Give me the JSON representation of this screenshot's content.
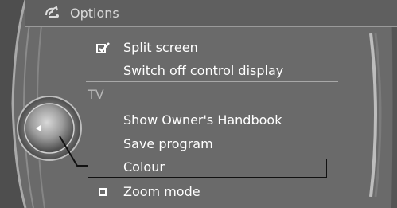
{
  "header": {
    "title": "Options",
    "icon": "options-icon"
  },
  "menu": {
    "items": [
      {
        "label": "Split screen",
        "icon": "checkmark-icon",
        "checked": true
      },
      {
        "label": "Switch off control display"
      },
      {
        "section": "TV"
      },
      {
        "label": "Show Owner's Handbook"
      },
      {
        "label": "Save program"
      },
      {
        "label": "Colour",
        "selected": true
      },
      {
        "label": "Zoom mode",
        "icon": "checkbox-icon",
        "checked": false
      }
    ]
  },
  "controller": {
    "icon": "controller-knob-icon",
    "direction_icon": "left-arrow-icon"
  },
  "colors": {
    "background": "#6a6a6a",
    "text": "#ffffff",
    "section_text": "#b8b8b8",
    "selection_border": "#111111"
  }
}
